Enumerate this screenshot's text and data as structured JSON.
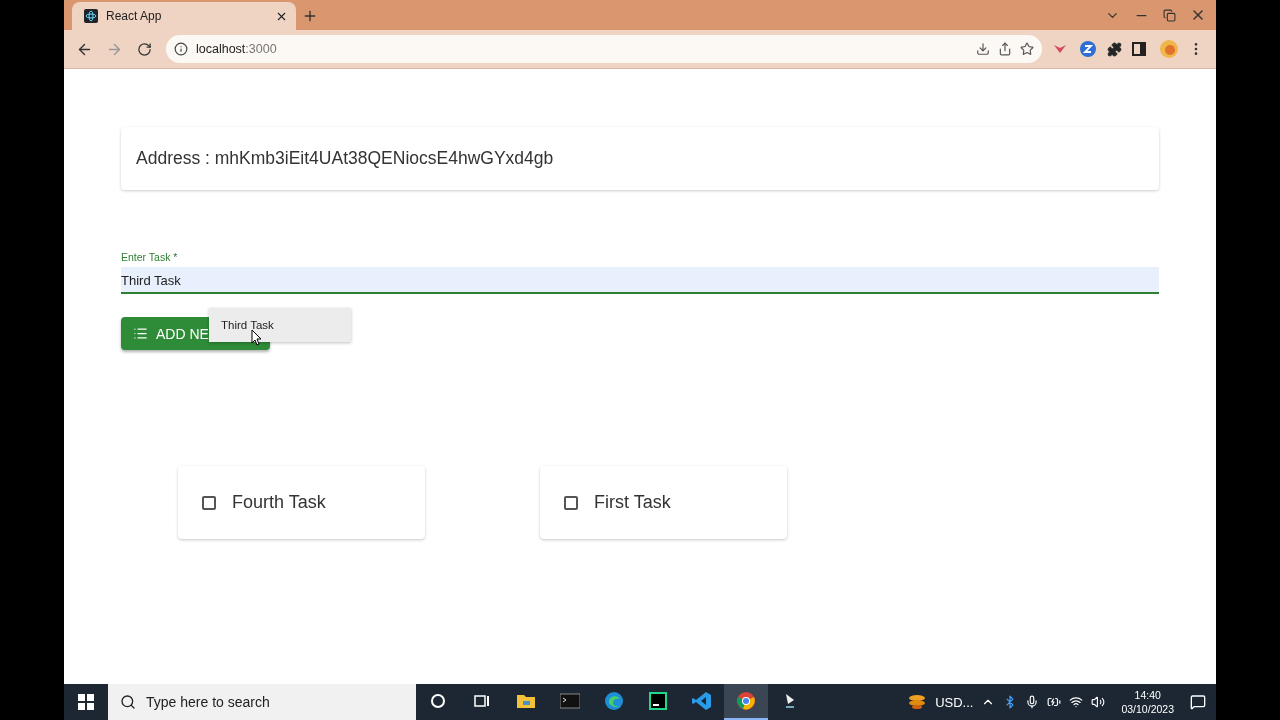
{
  "browser": {
    "tab_title": "React App",
    "host": "localhost",
    "port": ":3000"
  },
  "page": {
    "address_card": "Address : mhKmb3iEit4UAt38QENiocsE4hwGYxd4gb",
    "task_field": {
      "label": "Enter Task *",
      "value": "Third Task"
    },
    "suggestion": "Third Task",
    "add_button": "ADD NE",
    "tasks": [
      {
        "title": "Fourth Task",
        "checked": false
      },
      {
        "title": "First Task",
        "checked": false
      }
    ]
  },
  "taskbar": {
    "search_placeholder": "Type here to search",
    "apps": [
      {
        "kind": "cortana",
        "selected": false
      },
      {
        "kind": "taskview",
        "selected": false
      },
      {
        "kind": "folder",
        "selected": false
      },
      {
        "kind": "terminal",
        "selected": false
      },
      {
        "kind": "edge",
        "selected": false
      },
      {
        "kind": "ide",
        "selected": false
      },
      {
        "kind": "code",
        "selected": false
      },
      {
        "kind": "chrome",
        "selected": true
      },
      {
        "kind": "app",
        "selected": false
      }
    ],
    "tray_label": "USD...",
    "time": "14:40",
    "date": "03/10/2023"
  }
}
